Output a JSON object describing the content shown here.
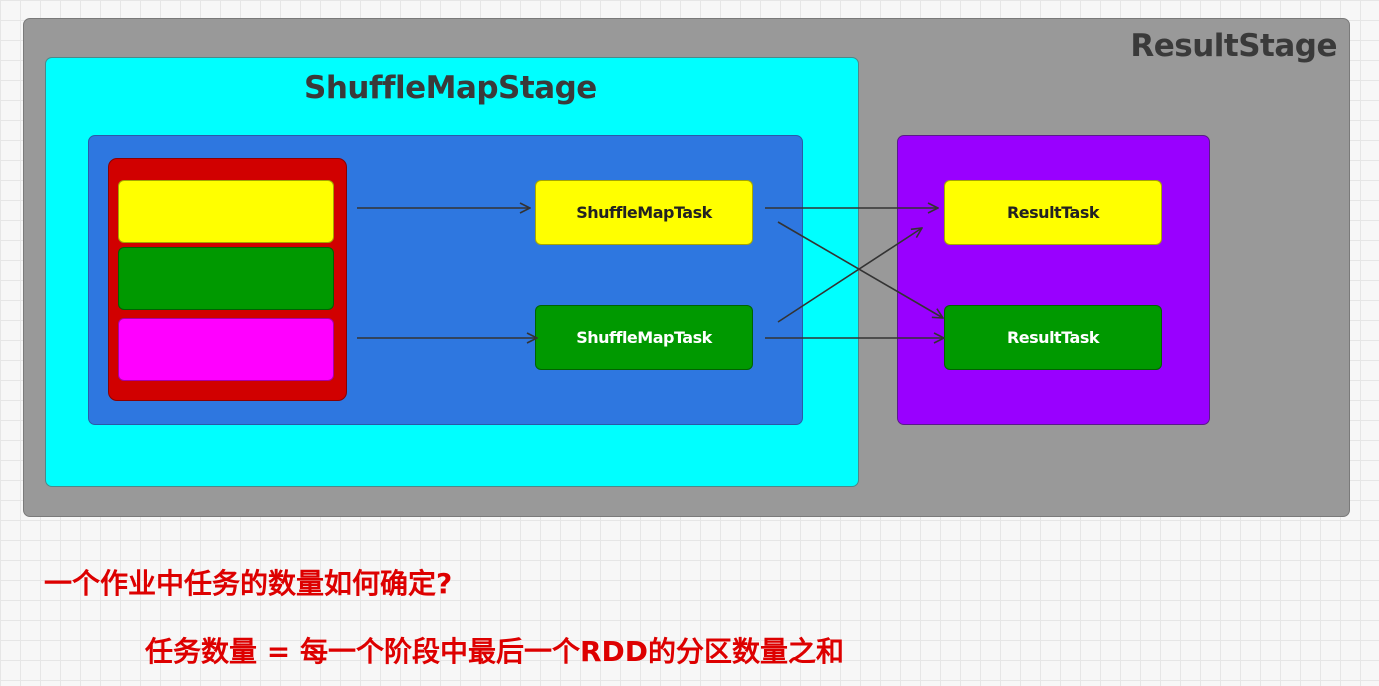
{
  "diagram": {
    "result_stage": {
      "title": "ResultStage"
    },
    "shuffle_map_stage": {
      "title": "ShuffleMapStage"
    },
    "shuffle_map_tasks": [
      {
        "label": "ShuffleMapTask",
        "color": "#ffff00"
      },
      {
        "label": "ShuffleMapTask",
        "color": "#009900"
      }
    ],
    "result_tasks": [
      {
        "label": "ResultTask",
        "color": "#ffff00"
      },
      {
        "label": "ResultTask",
        "color": "#009900"
      }
    ],
    "rdd_partitions": [
      {
        "color": "#ffff00"
      },
      {
        "color": "#009900"
      },
      {
        "color": "#ff00ff"
      }
    ],
    "colors": {
      "result_stage_bg": "#999999",
      "shuffle_stage_bg": "#00ffff",
      "rdd_area_bg": "#2e77e0",
      "rdd_block_bg": "#d10000",
      "result_area_bg": "#9900ff",
      "note_text": "#dd0000"
    }
  },
  "notes": {
    "question": "一个作业中任务的数量如何确定?",
    "answer": "任务数量 = 每一个阶段中最后一个RDD的分区数量之和"
  }
}
